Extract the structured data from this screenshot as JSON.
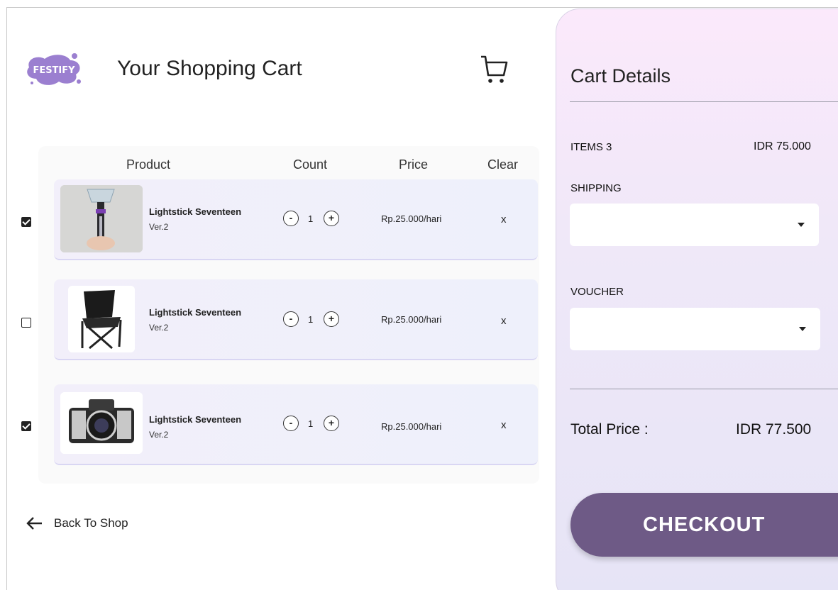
{
  "header": {
    "logo_text": "FESTIFY",
    "title": "Your Shopping Cart"
  },
  "table": {
    "columns": {
      "product": "Product",
      "count": "Count",
      "price": "Price",
      "clear": "Clear"
    },
    "rows": [
      {
        "checked": true,
        "name": "Lightstick Seventeen",
        "version": "Ver.2",
        "qty": "1",
        "price": "Rp.25.000/hari",
        "clear": "x",
        "thumb": "lightstick"
      },
      {
        "checked": false,
        "name": "Lightstick Seventeen",
        "version": "Ver.2",
        "qty": "1",
        "price": "Rp.25.000/hari",
        "clear": "x",
        "thumb": "folding-chair"
      },
      {
        "checked": true,
        "name": "Lightstick Seventeen",
        "version": "Ver.2",
        "qty": "1",
        "price": "Rp.25.000/hari",
        "clear": "x",
        "thumb": "camera"
      }
    ],
    "minus": "-",
    "plus": "+"
  },
  "back": {
    "label": "Back To Shop"
  },
  "details": {
    "title": "Cart Details",
    "items_label": "ITEMS 3",
    "items_value": "IDR 75.000",
    "shipping_label": "SHIPPING",
    "voucher_label": "VOUCHER",
    "total_label": "Total Price :",
    "total_value": "IDR 77.500",
    "checkout_label": "CHECKOUT"
  },
  "colors": {
    "checkout_button": "#6e5a86",
    "panel_top": "#fbe9fb",
    "panel_bottom": "#e6e4f6"
  }
}
